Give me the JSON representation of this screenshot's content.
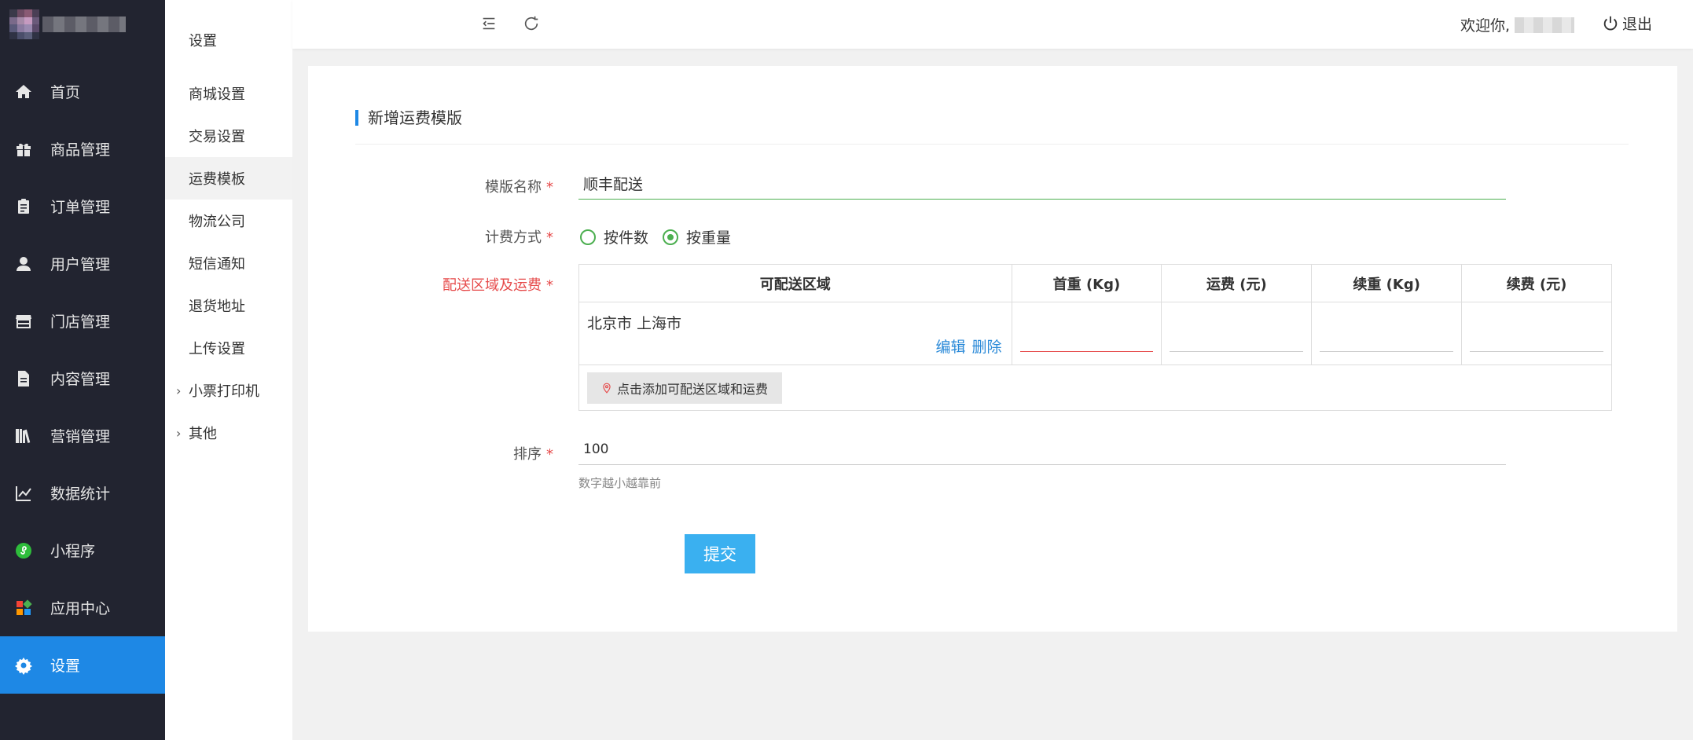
{
  "sidebar": {
    "items": [
      {
        "label": "首页",
        "icon": "home-icon"
      },
      {
        "label": "商品管理",
        "icon": "gift-icon"
      },
      {
        "label": "订单管理",
        "icon": "clipboard-icon"
      },
      {
        "label": "用户管理",
        "icon": "user-icon"
      },
      {
        "label": "门店管理",
        "icon": "store-icon"
      },
      {
        "label": "内容管理",
        "icon": "document-icon"
      },
      {
        "label": "营销管理",
        "icon": "books-icon"
      },
      {
        "label": "数据统计",
        "icon": "line-chart-icon"
      },
      {
        "label": "小程序",
        "icon": "mini-program-icon"
      },
      {
        "label": "应用中心",
        "icon": "apps-icon"
      },
      {
        "label": "设置",
        "icon": "gear-icon",
        "active": true
      }
    ],
    "active_color": "#1e88e5"
  },
  "submenu": {
    "title": "设置",
    "items": [
      {
        "label": "商城设置"
      },
      {
        "label": "交易设置"
      },
      {
        "label": "运费模板",
        "active": true
      },
      {
        "label": "物流公司"
      },
      {
        "label": "短信通知"
      },
      {
        "label": "退货地址"
      },
      {
        "label": "上传设置"
      },
      {
        "label": "小票打印机",
        "expandable": true
      },
      {
        "label": "其他",
        "expandable": true
      }
    ]
  },
  "topbar": {
    "welcome": "欢迎你,",
    "logout": "退出"
  },
  "form": {
    "header": "新增运费模版",
    "name_label": "模版名称",
    "name_value": "顺丰配送",
    "billing_label": "计费方式",
    "billing_options": [
      "按件数",
      "按重量"
    ],
    "billing_selected": "按重量",
    "region_label": "配送区域及运费",
    "table": {
      "headers": [
        "可配送区域",
        "首重 (Kg)",
        "运费 (元)",
        "续重 (Kg)",
        "续费 (元)"
      ],
      "rows": [
        {
          "region": "北京市 上海市",
          "edit": "编辑",
          "delete": "删除"
        }
      ],
      "add_button": "点击添加可配送区域和运费"
    },
    "sort_label": "排序",
    "sort_value": "100",
    "sort_hint": "数字越小越靠前",
    "submit": "提交",
    "required_mark": "*"
  }
}
